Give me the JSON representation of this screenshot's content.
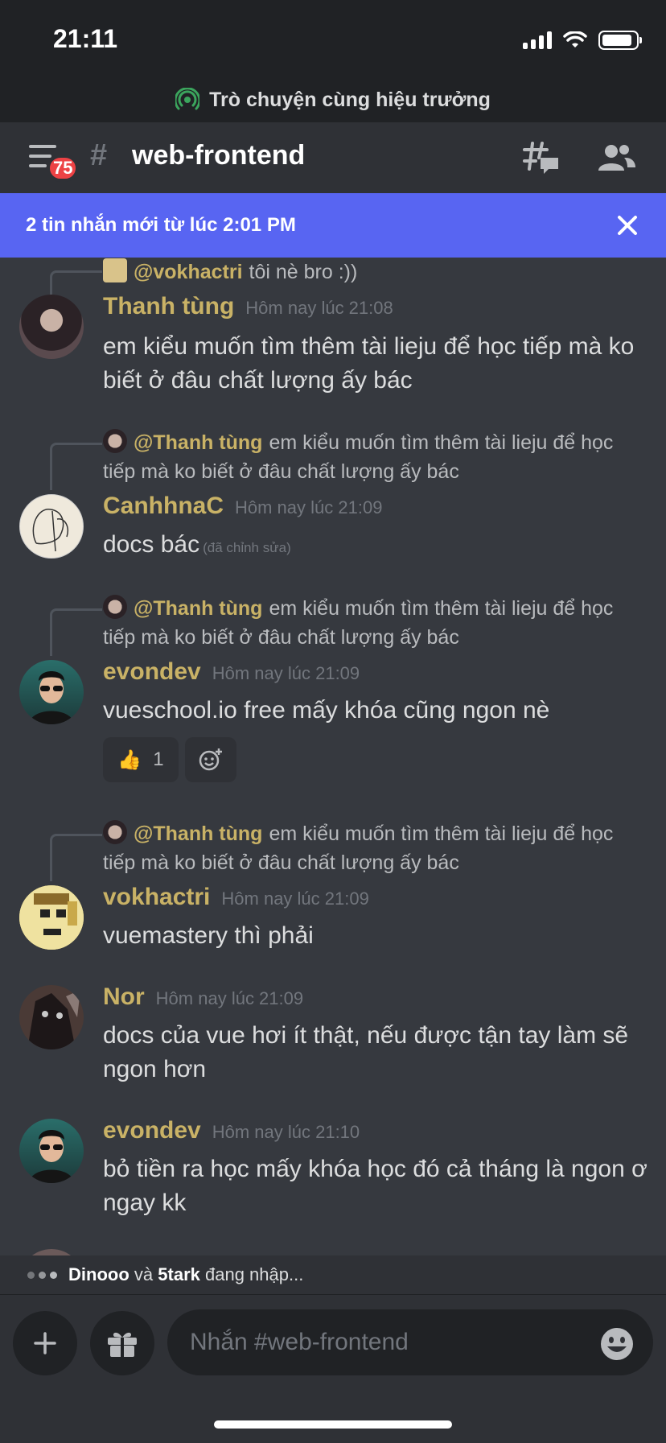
{
  "status_bar": {
    "time": "21:11"
  },
  "stage": {
    "title": "Trò chuyện cùng hiệu trưởng"
  },
  "header": {
    "mention_count": "75",
    "channel_name": "web-frontend"
  },
  "banner": {
    "text": "2 tin nhắn mới từ lúc 2:01 PM"
  },
  "messages": [
    {
      "reply_to": {
        "author": "@vokhactri",
        "text": "tôi nè bro :))"
      },
      "author": "Thanh tùng",
      "timestamp": "Hôm nay lúc 21:08",
      "content": "em kiểu muốn tìm thêm tài lieju để học tiếp mà ko biết ở đâu chất lượng ấy bác"
    },
    {
      "reply_to": {
        "author": "@Thanh tùng",
        "text": "em kiểu muốn tìm thêm tài lieju để học tiếp mà ko biết ở đâu chất lượng ấy bác"
      },
      "author": "CanhhnaC",
      "timestamp": "Hôm nay lúc 21:09",
      "content": "docs bác",
      "edited": "(đã chỉnh sửa)"
    },
    {
      "reply_to": {
        "author": "@Thanh tùng",
        "text": "em kiểu muốn tìm thêm tài lieju để học tiếp mà ko biết ở đâu chất lượng ấy bác"
      },
      "author": "evondev",
      "timestamp": "Hôm nay lúc 21:09",
      "content": "vueschool.io free mấy khóa cũng ngon nè",
      "reaction": {
        "emoji": "👍",
        "count": "1"
      }
    },
    {
      "reply_to": {
        "author": "@Thanh tùng",
        "text": "em kiểu muốn tìm thêm tài lieju để học tiếp mà ko biết ở đâu chất lượng ấy bác"
      },
      "author": "vokhactri",
      "timestamp": "Hôm nay lúc 21:09",
      "content": "vuemastery thì phải"
    },
    {
      "author": "Nor",
      "timestamp": "Hôm nay lúc 21:09",
      "content": "docs của vue hơi ít thật, nếu được tận tay làm sẽ ngon hơn"
    },
    {
      "author": "evondev",
      "timestamp": "Hôm nay lúc 21:10",
      "content": "bỏ tiền ra học mấy khóa học đó cả tháng là ngon ơ ngay kk"
    }
  ],
  "typing": {
    "user1": "Dinooo",
    "connector": "và",
    "user2": "5tark",
    "suffix": "đang nhập..."
  },
  "composer": {
    "placeholder": "Nhắn #web-frontend"
  },
  "colors": {
    "accent": "#5865f2",
    "name": "#c9b266",
    "bg": "#36393f",
    "badge": "#ed4245"
  },
  "icons": [
    "signal-icon",
    "wifi-icon",
    "battery-icon",
    "stage-icon",
    "hamburger-icon",
    "locked-channel-icon",
    "threads-icon",
    "members-icon",
    "close-icon",
    "add-reaction-icon",
    "plus-icon",
    "gift-icon",
    "emoji-icon"
  ]
}
